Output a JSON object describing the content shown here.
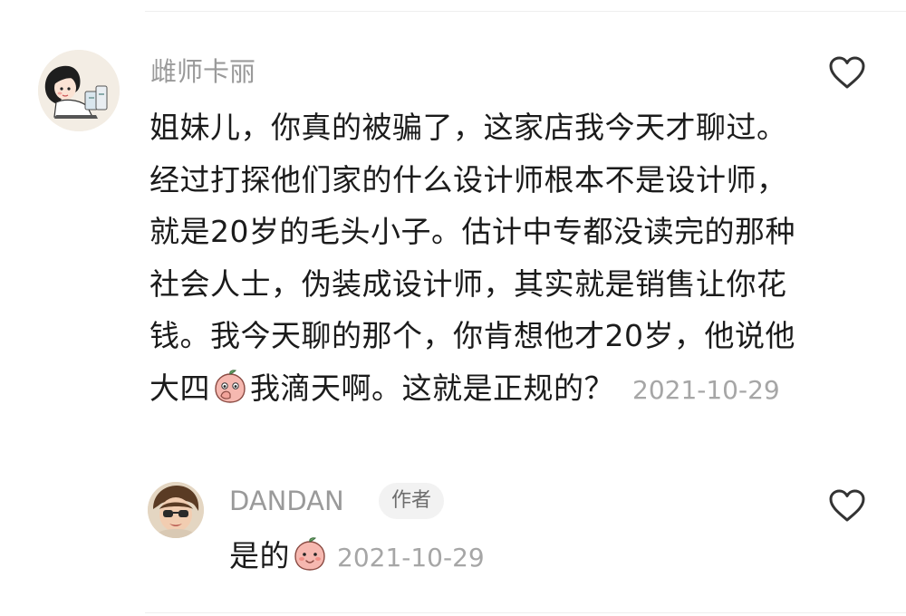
{
  "comments": [
    {
      "avatar_icon": "cartoon-avatar-icon",
      "username": "雌师卡丽",
      "text_part1": "姐妹儿，你真的被骗了，这家店我今天才聊过。经过打探他们家的什么设计师根本不是设计师，就是20岁的毛头小子。估计中专都没读完的那种社会人士，伪装成设计师，其实就是销售让你花钱。我今天聊的那个，你肯想他才20岁，他说他大四",
      "emoji": "peach-face-covering-mouth-emoji",
      "text_part2": "我滴天啊。这就是正规的？",
      "timestamp": "2021-10-29",
      "like_icon": "heart-outline-icon"
    }
  ],
  "reply": {
    "avatar_icon": "child-photo-avatar-icon",
    "username": "DANDAN",
    "badge": "作者",
    "text": "是的",
    "emoji": "peach-smile-emoji",
    "timestamp": "2021-10-29",
    "like_icon": "heart-outline-icon"
  },
  "colors": {
    "username": "#9a9a9a",
    "timestamp": "#a6a6a6",
    "text": "#1b1b1b",
    "badge_bg": "#f2f2f2",
    "emoji_peach": "#f6b8b0"
  }
}
